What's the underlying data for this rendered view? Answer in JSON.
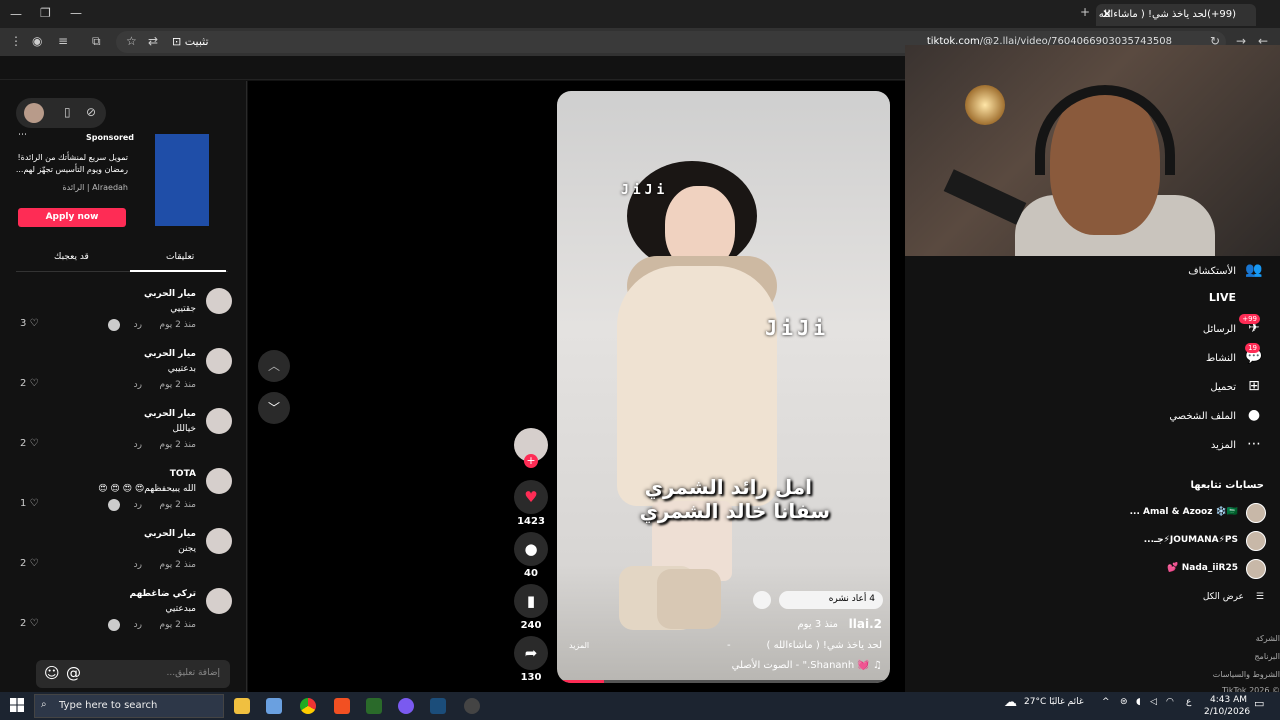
{
  "browser": {
    "tab_title": "(99+)لحد ياخذ شي! ( ماشاءالله ) -",
    "url_domain": "tiktok.com",
    "url_path": "/@2.llai/video/7604066903035743508",
    "install_label": "تثبيت"
  },
  "ad": {
    "sponsored": "Sponsored",
    "text": "تمويل سريع لمنشأتك من الرائدة! رمضان ويوم التأسيس تجهّز لهم...",
    "source": "Alraedah | الرائدة",
    "cta": "Apply now"
  },
  "comment_tabs": {
    "comments": "تعليقات",
    "creator": "قد يعجبك"
  },
  "comments": [
    {
      "name": "ميار الحربي",
      "text": "جقتييي",
      "time": "منذ 2 يوم",
      "reply": "رد",
      "likes": "3",
      "mini": true
    },
    {
      "name": "ميار الحربي",
      "text": "بدعتيبي",
      "time": "منذ 2 يوم",
      "reply": "رد",
      "likes": "2",
      "mini": false
    },
    {
      "name": "ميار الحربي",
      "text": "خياللل",
      "time": "منذ 2 يوم",
      "reply": "رد",
      "likes": "2",
      "mini": false
    },
    {
      "name": "TOTA",
      "text": "الله يبيحفظهم😍 😍 😍 😍",
      "time": "منذ 2 يوم",
      "reply": "رد",
      "likes": "1",
      "mini": true
    },
    {
      "name": "ميار الحربي",
      "text": "يجنن",
      "time": "منذ 2 يوم",
      "reply": "رد",
      "likes": "2",
      "mini": false
    },
    {
      "name": "تركي ضاغطهم",
      "text": "مبدعتيي",
      "time": "منذ 2 يوم",
      "reply": "رد",
      "likes": "2",
      "mini": true
    }
  ],
  "comment_input": {
    "placeholder": "إضافة تعليق..."
  },
  "video": {
    "watermark": "JiJi",
    "line1": "امل رائد الشمري",
    "line2": "سفانا خالد الشمري",
    "author": "llai.2",
    "ago": "منذ 3 يوم",
    "title": "لحد ياخذ شي! ( ماشاءالله )",
    "more": "المزيد",
    "dash": "-",
    "sound": "♫ 💓 Shananh.\" - الصوت الأصلي",
    "repost": "4 أعاد نشره"
  },
  "actions": {
    "likes": "1423",
    "comments": "40",
    "saves": "240",
    "shares": "130"
  },
  "nav": [
    {
      "label": "الأستكشاف",
      "icon": "👥",
      "badge": ""
    },
    {
      "label": "LIVE",
      "icon": "",
      "badge": ""
    },
    {
      "label": "الرسائل",
      "icon": "✈",
      "badge": "99+"
    },
    {
      "label": "النشاط",
      "icon": "💬",
      "badge": "19"
    },
    {
      "label": "تحميل",
      "icon": "⊞",
      "badge": ""
    },
    {
      "label": "الملف الشخصي",
      "icon": "●",
      "badge": ""
    },
    {
      "label": "المزيد",
      "icon": "⋯",
      "badge": ""
    }
  ],
  "following": {
    "heading": "حسابات تتابعها",
    "accounts": [
      "Amal & Azooz ❄️🇸🇦 ...",
      "JOUMANA⚡PS⚡جـ...",
      "Nada_iiR25 💕"
    ],
    "see_all": "عرض الكل"
  },
  "footer": [
    "الشركة",
    "البرنامج",
    "الشروط والسياسات",
    "© 2026 TikTok"
  ],
  "taskbar": {
    "search": "Type here to search",
    "weather": "27°C غائم غالبًا",
    "time": "4:43 AM",
    "date": "2/10/2026",
    "lang": "ع"
  }
}
